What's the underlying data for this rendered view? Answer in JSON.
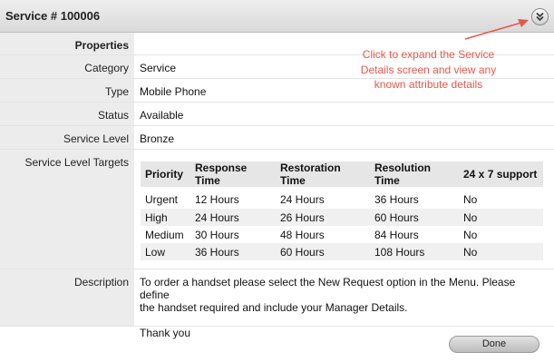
{
  "header": {
    "title": "Service # 100006"
  },
  "annotation": {
    "text": "Click to expand the Service Details screen and view any known attribute details"
  },
  "properties": {
    "heading": "Properties",
    "category_label": "Category",
    "category_value": "Service",
    "type_label": "Type",
    "type_value": "Mobile Phone",
    "status_label": "Status",
    "status_value": "Available",
    "service_level_label": "Service Level",
    "service_level_value": "Bronze",
    "slt_label": "Service Level Targets",
    "description_label": "Description"
  },
  "slt_table": {
    "headers": [
      "Priority",
      "Response Time",
      "Restoration Time",
      "Resolution Time",
      "24 x 7 support"
    ],
    "rows": [
      [
        "Urgent",
        "12 Hours",
        "24 Hours",
        "36 Hours",
        "No"
      ],
      [
        "High",
        "24 Hours",
        "26 Hours",
        "60 Hours",
        "No"
      ],
      [
        "Medium",
        "30 Hours",
        "48 Hours",
        "84 Hours",
        "No"
      ],
      [
        "Low",
        "36 Hours",
        "60 Hours",
        "108 Hours",
        "No"
      ]
    ]
  },
  "description": {
    "line1": "To order a handset please select the New Request option in the Menu. Please define",
    "line2": "the handset required and include your Manager Details.",
    "line3": "Thank you"
  },
  "buttons": {
    "done": "Done"
  },
  "icons": {
    "expand": "double-chevron-down-icon"
  },
  "colors": {
    "annotation": "#e8574a"
  }
}
